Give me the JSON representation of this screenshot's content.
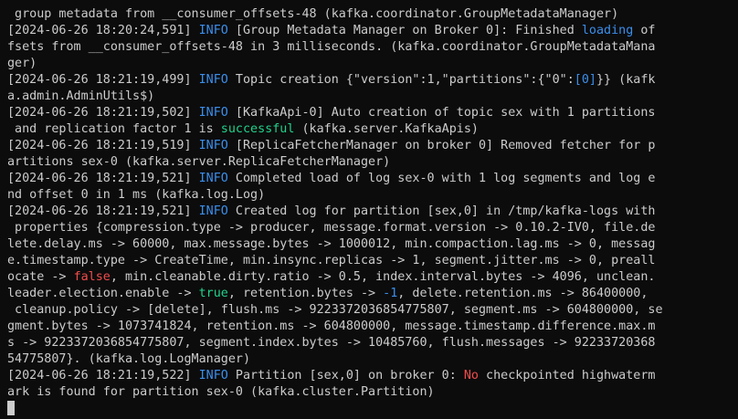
{
  "terminal": {
    "lines": [
      [
        {
          "t": " group metadata from __consumer_offsets-48 (kafka.coordinator.GroupMetadataManager)"
        }
      ],
      [
        {
          "t": "[2024-06-26 18:20:24,591] "
        },
        {
          "t": "INFO",
          "c": "info"
        },
        {
          "t": " [Group Metadata Manager on Broker 0]: Finished "
        },
        {
          "t": "loading",
          "c": "blue"
        },
        {
          "t": " of"
        }
      ],
      [
        {
          "t": "fsets from __consumer_offsets-48 in 3 milliseconds. (kafka.coordinator.GroupMetadataMana"
        }
      ],
      [
        {
          "t": "ger)"
        }
      ],
      [
        {
          "t": "[2024-06-26 18:21:19,499] "
        },
        {
          "t": "INFO",
          "c": "info"
        },
        {
          "t": " Topic creation {\"version\":1,\"partitions\":{\"0\":"
        },
        {
          "t": "[0]",
          "c": "blue"
        },
        {
          "t": "}} (kafk"
        }
      ],
      [
        {
          "t": "a.admin.AdminUtils$)"
        }
      ],
      [
        {
          "t": "[2024-06-26 18:21:19,502] "
        },
        {
          "t": "INFO",
          "c": "info"
        },
        {
          "t": " [KafkaApi-0] Auto creation of topic sex with 1 partitions"
        }
      ],
      [
        {
          "t": " and replication factor 1 is "
        },
        {
          "t": "successful",
          "c": "green"
        },
        {
          "t": " (kafka.server.KafkaApis)"
        }
      ],
      [
        {
          "t": "[2024-06-26 18:21:19,519] "
        },
        {
          "t": "INFO",
          "c": "info"
        },
        {
          "t": " [ReplicaFetcherManager on broker 0] Removed fetcher for p"
        }
      ],
      [
        {
          "t": "artitions sex-0 (kafka.server.ReplicaFetcherManager)"
        }
      ],
      [
        {
          "t": "[2024-06-26 18:21:19,521] "
        },
        {
          "t": "INFO",
          "c": "info"
        },
        {
          "t": " Completed load of log sex-0 with 1 log segments and log e"
        }
      ],
      [
        {
          "t": "nd offset 0 in 1 ms (kafka.log.Log)"
        }
      ],
      [
        {
          "t": "[2024-06-26 18:21:19,521] "
        },
        {
          "t": "INFO",
          "c": "info"
        },
        {
          "t": " Created log for partition [sex,0] in /tmp/kafka-logs with"
        }
      ],
      [
        {
          "t": " properties {compression.type -> producer, message.format.version -> 0.10.2-IV0, file.de"
        }
      ],
      [
        {
          "t": "lete.delay.ms -> 60000, max.message.bytes -> 1000012, min.compaction.lag.ms -> 0, messag"
        }
      ],
      [
        {
          "t": "e.timestamp.type -> CreateTime, min.insync.replicas -> 1, segment.jitter.ms -> 0, preall"
        }
      ],
      [
        {
          "t": "ocate -> "
        },
        {
          "t": "false",
          "c": "red"
        },
        {
          "t": ", min.cleanable.dirty.ratio -> 0.5, index.interval.bytes -> 4096, unclean."
        }
      ],
      [
        {
          "t": "leader.election.enable -> "
        },
        {
          "t": "true",
          "c": "green"
        },
        {
          "t": ", retention.bytes -> "
        },
        {
          "t": "-1",
          "c": "blue"
        },
        {
          "t": ", delete.retention.ms -> 86400000,"
        }
      ],
      [
        {
          "t": " cleanup.policy -> [delete], flush.ms -> 9223372036854775807, segment.ms -> 604800000, se"
        }
      ],
      [
        {
          "t": "gment.bytes -> 1073741824, retention.ms -> 604800000, message.timestamp.difference.max.m"
        }
      ],
      [
        {
          "t": "s -> 9223372036854775807, segment.index.bytes -> 10485760, flush.messages -> 92233720368"
        }
      ],
      [
        {
          "t": "54775807}. (kafka.log.LogManager)"
        }
      ],
      [
        {
          "t": "[2024-06-26 18:21:19,522] "
        },
        {
          "t": "INFO",
          "c": "info"
        },
        {
          "t": " Partition [sex,0] on broker 0: "
        },
        {
          "t": "No",
          "c": "red"
        },
        {
          "t": " checkpointed highwaterm"
        }
      ],
      [
        {
          "t": "ark is found for partition sex-0 (kafka.cluster.Partition)"
        }
      ]
    ]
  }
}
